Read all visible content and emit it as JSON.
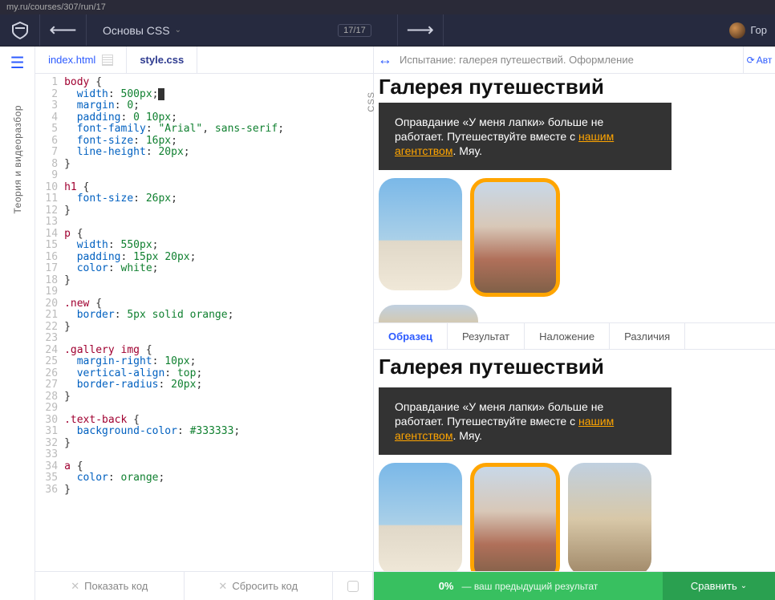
{
  "browser": {
    "url": "my.ru/courses/307/run/17"
  },
  "header": {
    "course_title": "Основы CSS",
    "progress": "17/17",
    "username": "Гор"
  },
  "sidebar": {
    "theory_label": "Теория и видеоразбор"
  },
  "tabs": {
    "file1": "index.html",
    "file2": "style.css",
    "css_label": "CSS"
  },
  "code": {
    "lines": [
      [
        {
          "c": "t-sel",
          "t": "body"
        },
        {
          "c": "t-punc",
          "t": " "
        },
        {
          "c": "t-brace",
          "t": "{"
        }
      ],
      [
        {
          "c": "t-punc",
          "t": "  "
        },
        {
          "c": "t-prop",
          "t": "width"
        },
        {
          "c": "t-punc",
          "t": ": "
        },
        {
          "c": "t-num",
          "t": "500px"
        },
        {
          "c": "t-punc",
          "t": ";"
        },
        {
          "c": "t-cursor",
          "t": "|"
        }
      ],
      [
        {
          "c": "t-punc",
          "t": "  "
        },
        {
          "c": "t-prop",
          "t": "margin"
        },
        {
          "c": "t-punc",
          "t": ": "
        },
        {
          "c": "t-num",
          "t": "0"
        },
        {
          "c": "t-punc",
          "t": ";"
        }
      ],
      [
        {
          "c": "t-punc",
          "t": "  "
        },
        {
          "c": "t-prop",
          "t": "padding"
        },
        {
          "c": "t-punc",
          "t": ": "
        },
        {
          "c": "t-num",
          "t": "0"
        },
        {
          "c": "t-punc",
          "t": " "
        },
        {
          "c": "t-num",
          "t": "10px"
        },
        {
          "c": "t-punc",
          "t": ";"
        }
      ],
      [
        {
          "c": "t-punc",
          "t": "  "
        },
        {
          "c": "t-prop",
          "t": "font-family"
        },
        {
          "c": "t-punc",
          "t": ": "
        },
        {
          "c": "t-str",
          "t": "\"Arial\""
        },
        {
          "c": "t-punc",
          "t": ", "
        },
        {
          "c": "t-kw",
          "t": "sans-serif"
        },
        {
          "c": "t-punc",
          "t": ";"
        }
      ],
      [
        {
          "c": "t-punc",
          "t": "  "
        },
        {
          "c": "t-prop",
          "t": "font-size"
        },
        {
          "c": "t-punc",
          "t": ": "
        },
        {
          "c": "t-num",
          "t": "16px"
        },
        {
          "c": "t-punc",
          "t": ";"
        }
      ],
      [
        {
          "c": "t-punc",
          "t": "  "
        },
        {
          "c": "t-prop",
          "t": "line-height"
        },
        {
          "c": "t-punc",
          "t": ": "
        },
        {
          "c": "t-num",
          "t": "20px"
        },
        {
          "c": "t-punc",
          "t": ";"
        }
      ],
      [
        {
          "c": "t-brace",
          "t": "}"
        }
      ],
      [
        {
          "c": "t-punc",
          "t": ""
        }
      ],
      [
        {
          "c": "t-sel",
          "t": "h1"
        },
        {
          "c": "t-punc",
          "t": " "
        },
        {
          "c": "t-brace",
          "t": "{"
        }
      ],
      [
        {
          "c": "t-punc",
          "t": "  "
        },
        {
          "c": "t-prop",
          "t": "font-size"
        },
        {
          "c": "t-punc",
          "t": ": "
        },
        {
          "c": "t-num",
          "t": "26px"
        },
        {
          "c": "t-punc",
          "t": ";"
        }
      ],
      [
        {
          "c": "t-brace",
          "t": "}"
        }
      ],
      [
        {
          "c": "t-punc",
          "t": ""
        }
      ],
      [
        {
          "c": "t-sel",
          "t": "p"
        },
        {
          "c": "t-punc",
          "t": " "
        },
        {
          "c": "t-brace",
          "t": "{"
        }
      ],
      [
        {
          "c": "t-punc",
          "t": "  "
        },
        {
          "c": "t-prop",
          "t": "width"
        },
        {
          "c": "t-punc",
          "t": ": "
        },
        {
          "c": "t-num",
          "t": "550px"
        },
        {
          "c": "t-punc",
          "t": ";"
        }
      ],
      [
        {
          "c": "t-punc",
          "t": "  "
        },
        {
          "c": "t-prop",
          "t": "padding"
        },
        {
          "c": "t-punc",
          "t": ": "
        },
        {
          "c": "t-num",
          "t": "15px"
        },
        {
          "c": "t-punc",
          "t": " "
        },
        {
          "c": "t-num",
          "t": "20px"
        },
        {
          "c": "t-punc",
          "t": ";"
        }
      ],
      [
        {
          "c": "t-punc",
          "t": "  "
        },
        {
          "c": "t-prop",
          "t": "color"
        },
        {
          "c": "t-punc",
          "t": ": "
        },
        {
          "c": "t-kw",
          "t": "white"
        },
        {
          "c": "t-punc",
          "t": ";"
        }
      ],
      [
        {
          "c": "t-brace",
          "t": "}"
        }
      ],
      [
        {
          "c": "t-punc",
          "t": ""
        }
      ],
      [
        {
          "c": "t-sel",
          "t": ".new"
        },
        {
          "c": "t-punc",
          "t": " "
        },
        {
          "c": "t-brace",
          "t": "{"
        }
      ],
      [
        {
          "c": "t-punc",
          "t": "  "
        },
        {
          "c": "t-prop",
          "t": "border"
        },
        {
          "c": "t-punc",
          "t": ": "
        },
        {
          "c": "t-num",
          "t": "5px"
        },
        {
          "c": "t-punc",
          "t": " "
        },
        {
          "c": "t-kw",
          "t": "solid"
        },
        {
          "c": "t-punc",
          "t": " "
        },
        {
          "c": "t-kw",
          "t": "orange"
        },
        {
          "c": "t-punc",
          "t": ";"
        }
      ],
      [
        {
          "c": "t-brace",
          "t": "}"
        }
      ],
      [
        {
          "c": "t-punc",
          "t": ""
        }
      ],
      [
        {
          "c": "t-sel",
          "t": ".gallery"
        },
        {
          "c": "t-punc",
          "t": " "
        },
        {
          "c": "t-sel",
          "t": "img"
        },
        {
          "c": "t-punc",
          "t": " "
        },
        {
          "c": "t-brace",
          "t": "{"
        }
      ],
      [
        {
          "c": "t-punc",
          "t": "  "
        },
        {
          "c": "t-prop",
          "t": "margin-right"
        },
        {
          "c": "t-punc",
          "t": ": "
        },
        {
          "c": "t-num",
          "t": "10px"
        },
        {
          "c": "t-punc",
          "t": ";"
        }
      ],
      [
        {
          "c": "t-punc",
          "t": "  "
        },
        {
          "c": "t-prop",
          "t": "vertical-align"
        },
        {
          "c": "t-punc",
          "t": ": "
        },
        {
          "c": "t-kw",
          "t": "top"
        },
        {
          "c": "t-punc",
          "t": ";"
        }
      ],
      [
        {
          "c": "t-punc",
          "t": "  "
        },
        {
          "c": "t-prop",
          "t": "border-radius"
        },
        {
          "c": "t-punc",
          "t": ": "
        },
        {
          "c": "t-num",
          "t": "20px"
        },
        {
          "c": "t-punc",
          "t": ";"
        }
      ],
      [
        {
          "c": "t-brace",
          "t": "}"
        }
      ],
      [
        {
          "c": "t-punc",
          "t": ""
        }
      ],
      [
        {
          "c": "t-sel",
          "t": ".text-back"
        },
        {
          "c": "t-punc",
          "t": " "
        },
        {
          "c": "t-brace",
          "t": "{"
        }
      ],
      [
        {
          "c": "t-punc",
          "t": "  "
        },
        {
          "c": "t-prop",
          "t": "background-color"
        },
        {
          "c": "t-punc",
          "t": ": "
        },
        {
          "c": "t-num",
          "t": "#333333"
        },
        {
          "c": "t-punc",
          "t": ";"
        }
      ],
      [
        {
          "c": "t-brace",
          "t": "}"
        }
      ],
      [
        {
          "c": "t-punc",
          "t": ""
        }
      ],
      [
        {
          "c": "t-sel",
          "t": "a"
        },
        {
          "c": "t-punc",
          "t": " "
        },
        {
          "c": "t-brace",
          "t": "{"
        }
      ],
      [
        {
          "c": "t-punc",
          "t": "  "
        },
        {
          "c": "t-prop",
          "t": "color"
        },
        {
          "c": "t-punc",
          "t": ": "
        },
        {
          "c": "t-kw",
          "t": "orange"
        },
        {
          "c": "t-punc",
          "t": ";"
        }
      ],
      [
        {
          "c": "t-brace",
          "t": "}"
        }
      ]
    ]
  },
  "preview": {
    "header_title": "Испытание: галерея путешествий. Оформление",
    "auto_label": "Авт",
    "gallery_title": "Галерея путешествий",
    "intro_1": "Оправдание «У меня лапки» больше не работает. Путешествуйте вместе с ",
    "intro_link": "нашим агентством",
    "intro_2": ". Мяу."
  },
  "compare_tabs": {
    "t1": "Образец",
    "t2": "Результат",
    "t3": "Наложение",
    "t4": "Различия"
  },
  "bottom_editor": {
    "show_answer": "Показать код",
    "reset": "Сбросить код"
  },
  "bottom_preview": {
    "score": "0%",
    "score_sub": "— ваш предыдущий результат",
    "compare": "Сравнить"
  }
}
